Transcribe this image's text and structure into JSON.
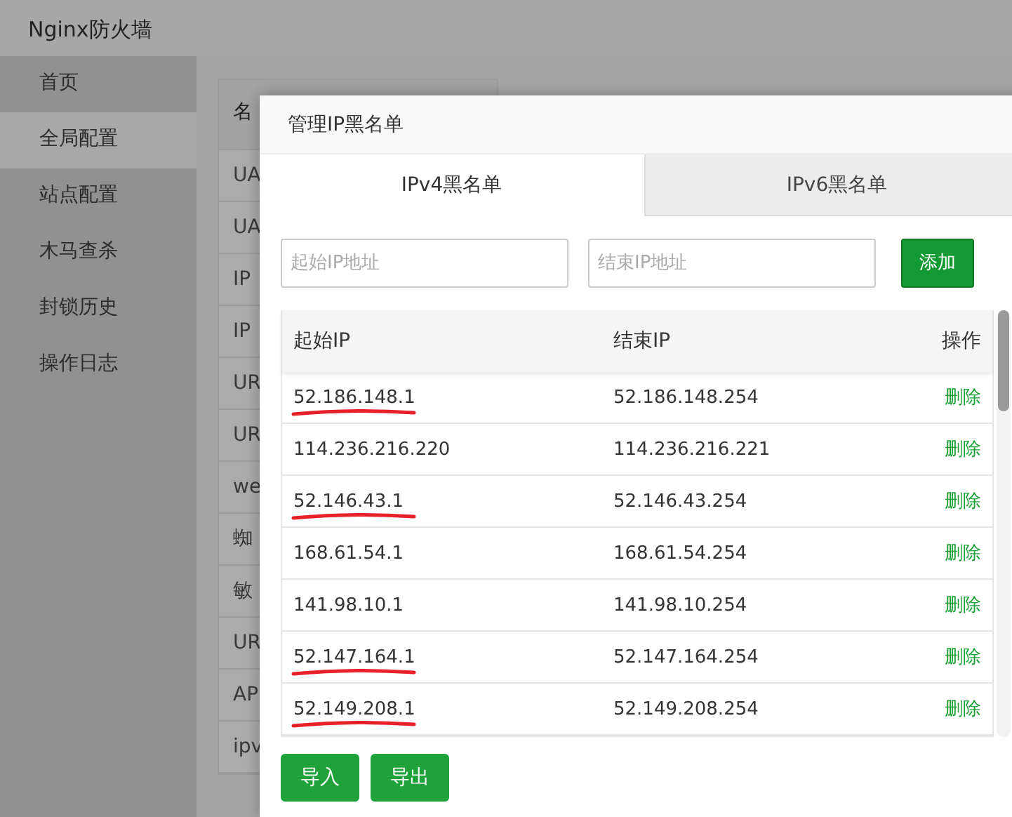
{
  "app": {
    "title": "Nginx防火墙"
  },
  "sidebar": {
    "items": [
      {
        "label": "首页",
        "selected": false
      },
      {
        "label": "全局配置",
        "selected": true
      },
      {
        "label": "站点配置",
        "selected": false
      },
      {
        "label": "木马查杀",
        "selected": false
      },
      {
        "label": "封锁历史",
        "selected": false
      },
      {
        "label": "操作日志",
        "selected": false
      }
    ]
  },
  "background_table": {
    "header": "名",
    "rows": [
      "UA",
      "UA",
      "IP",
      "IP",
      "UR",
      "UR",
      "we",
      "蜘",
      "敏",
      "UR",
      "AP",
      "ipv"
    ]
  },
  "dialog": {
    "title": "管理IP黑名单",
    "tabs": [
      {
        "label": "IPv4黑名单",
        "selected": true
      },
      {
        "label": "IPv6黑名单",
        "selected": false
      }
    ],
    "start_field": {
      "placeholder": "起始IP地址"
    },
    "end_field": {
      "placeholder": "结束IP地址"
    },
    "add_button": "添加",
    "columns": [
      "起始IP",
      "结束IP",
      "操作"
    ],
    "rows": [
      {
        "start": "52.186.148.1",
        "end": "52.186.148.254",
        "action": "删除",
        "underlined": true
      },
      {
        "start": "114.236.216.220",
        "end": "114.236.216.221",
        "action": "删除",
        "underlined": false
      },
      {
        "start": "52.146.43.1",
        "end": "52.146.43.254",
        "action": "删除",
        "underlined": true
      },
      {
        "start": "168.61.54.1",
        "end": "168.61.54.254",
        "action": "删除",
        "underlined": false
      },
      {
        "start": "141.98.10.1",
        "end": "141.98.10.254",
        "action": "删除",
        "underlined": false
      },
      {
        "start": "52.147.164.1",
        "end": "52.147.164.254",
        "action": "删除",
        "underlined": true
      },
      {
        "start": "52.149.208.1",
        "end": "52.149.208.254",
        "action": "删除",
        "underlined": true
      }
    ],
    "buttons": [
      "导入",
      "导出"
    ]
  }
}
